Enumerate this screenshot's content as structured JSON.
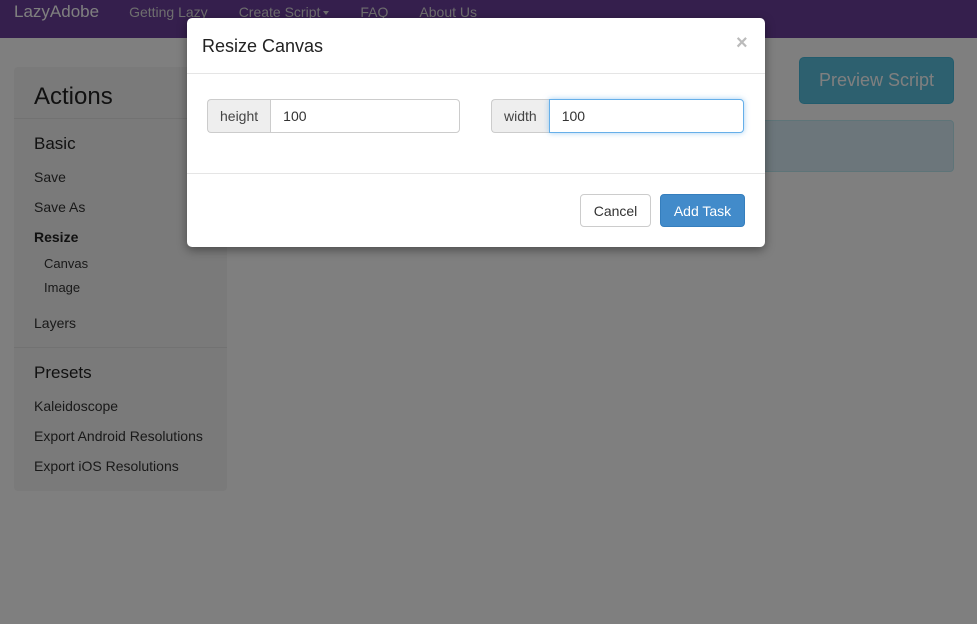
{
  "navbar": {
    "brand": "LazyAdobe",
    "items": [
      {
        "label": "Getting Lazy"
      },
      {
        "label": "Create Script"
      },
      {
        "label": "FAQ"
      },
      {
        "label": "About Us"
      }
    ]
  },
  "sidebar": {
    "title": "Actions",
    "basic": {
      "heading": "Basic",
      "items": [
        "Save",
        "Save As",
        "Resize",
        "Layers"
      ],
      "resize_sub": [
        "Canvas",
        "Image"
      ]
    },
    "presets": {
      "heading": "Presets",
      "items": [
        "Kaleidoscope",
        "Export Android Resolutions",
        "Export iOS Resolutions"
      ]
    }
  },
  "main": {
    "preview_label": "Preview Script"
  },
  "modal": {
    "title": "Resize Canvas",
    "close": "×",
    "height_label": "height",
    "height_value": "100",
    "width_label": "width",
    "width_value": "100",
    "cancel_label": "Cancel",
    "add_label": "Add Task"
  },
  "colors": {
    "navbar": "#6a3f9a",
    "primary": "#428bca",
    "info": "#5bc0de"
  }
}
